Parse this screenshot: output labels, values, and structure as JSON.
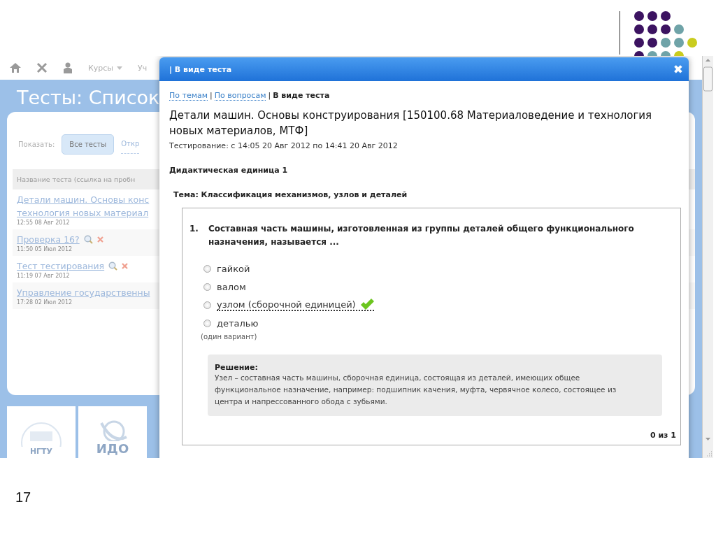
{
  "slide": {
    "page_number": "17"
  },
  "app": {
    "nav": [
      {
        "label": "Курсы",
        "dropdown": true
      },
      {
        "label": "Уч",
        "dropdown": false
      }
    ],
    "page_title": "Тесты: Список",
    "filter": {
      "label": "Показать:",
      "options": [
        {
          "label": "Все тесты",
          "selected": true
        },
        {
          "label": "Откр",
          "selected": false
        }
      ]
    },
    "table": {
      "column": "Название теста (ссылка на пробн",
      "rows": [
        {
          "title_lines": [
            "Детали машин. Основы конс",
            "технология новых материал"
          ],
          "date": "12:55 08 Авг 2012",
          "actions": false
        },
        {
          "title_lines": [
            "Проверка 16?"
          ],
          "date": "11:50 05 Июл 2012",
          "actions": true
        },
        {
          "title_lines": [
            "Тест тестирования"
          ],
          "date": "11:19 07 Авг 2012",
          "actions": true
        },
        {
          "title_lines": [
            "Управление государственны"
          ],
          "date": "17:28 02 Июл 2012",
          "actions": false
        }
      ]
    },
    "logos": [
      {
        "text": "НГТУ"
      },
      {
        "text": "ИДО"
      }
    ]
  },
  "dialog": {
    "title": "| В виде теста",
    "close": "✖",
    "tab_separator": "|",
    "tabs": [
      {
        "label": "По темам",
        "selected": false
      },
      {
        "label": "По вопросам",
        "selected": false
      },
      {
        "label": "В виде теста",
        "selected": true
      }
    ],
    "heading": "Детали машин. Основы конструирования [150100.68 Материаловедение и технология новых материалов, МТФ]",
    "period": "Тестирование: с 14:05 20 Авг 2012 по 14:41 20 Авг 2012",
    "unit": "Дидактическая единица 1",
    "topic": "Тема: Классификация механизмов, узлов и деталей",
    "question": {
      "number": "1.",
      "text": "Составная часть машины, изготовленная из группы деталей общего функционального назначения, называется ...",
      "options": [
        {
          "label": "гайкой",
          "correct": false,
          "selected": false
        },
        {
          "label": "валом",
          "correct": false,
          "selected": false
        },
        {
          "label": "узлом (сборочной единицей)",
          "correct": true,
          "selected": false
        },
        {
          "label": "деталью",
          "correct": false,
          "selected": false
        }
      ],
      "hint": "(один вариант)",
      "solution": {
        "label": "Решение:",
        "text": "Узел – составная часть машины, сборочная единица, состоящая из деталей, имеющих общее функциональное назначение, например: подшипник качения, муфта, червячное колесо, состоящее из центра и напрессованного обода с зубьями."
      },
      "score": "0 из 1"
    }
  }
}
